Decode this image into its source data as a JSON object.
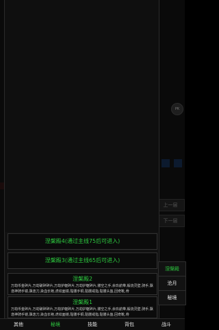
{
  "background": {
    "badge_text": "PK",
    "side_buttons": [
      "上一层",
      "下一层"
    ]
  },
  "dungeons": [
    {
      "title": "涅槃殿4(通过主线75后可进入)",
      "desc": ""
    },
    {
      "title": "涅槃殿3(通过主线65后可进入)",
      "desc": ""
    },
    {
      "title": "涅槃殿2",
      "desc": "万劫币金碎片,万劫破碎碎片,万劫护躯碎片,万劫护躯碎片,镂空之手,余玖航带,锻烧灵壁,骑手,飘逸神骑手镜,飘逸刀,染血长袍,虎纹面镜,骷髅手铜,骷髅戒指,骷髅头盔,回奇靴,骨"
    },
    {
      "title": "涅槃殿1",
      "desc": "万劫币金碎片,万劫破碎碎片,万劫护躯碎片,万劫护躯碎片,镂空之手,余玖航带,锻烧灵壁,骑手,飘逸神骑手镜,飘逸刀,染血长袍,虎纹面镜,骷髅手铜,骷髅戒指,骷髅头盔,回奇靴,骨"
    }
  ],
  "side_tabs": [
    "涅槃殿",
    "沧月",
    "秘境"
  ],
  "bottom_nav": [
    "其他",
    "秘境",
    "技能",
    "背包",
    "战斗"
  ],
  "colors": {
    "active": "#2ecc40",
    "background": "#000000"
  }
}
